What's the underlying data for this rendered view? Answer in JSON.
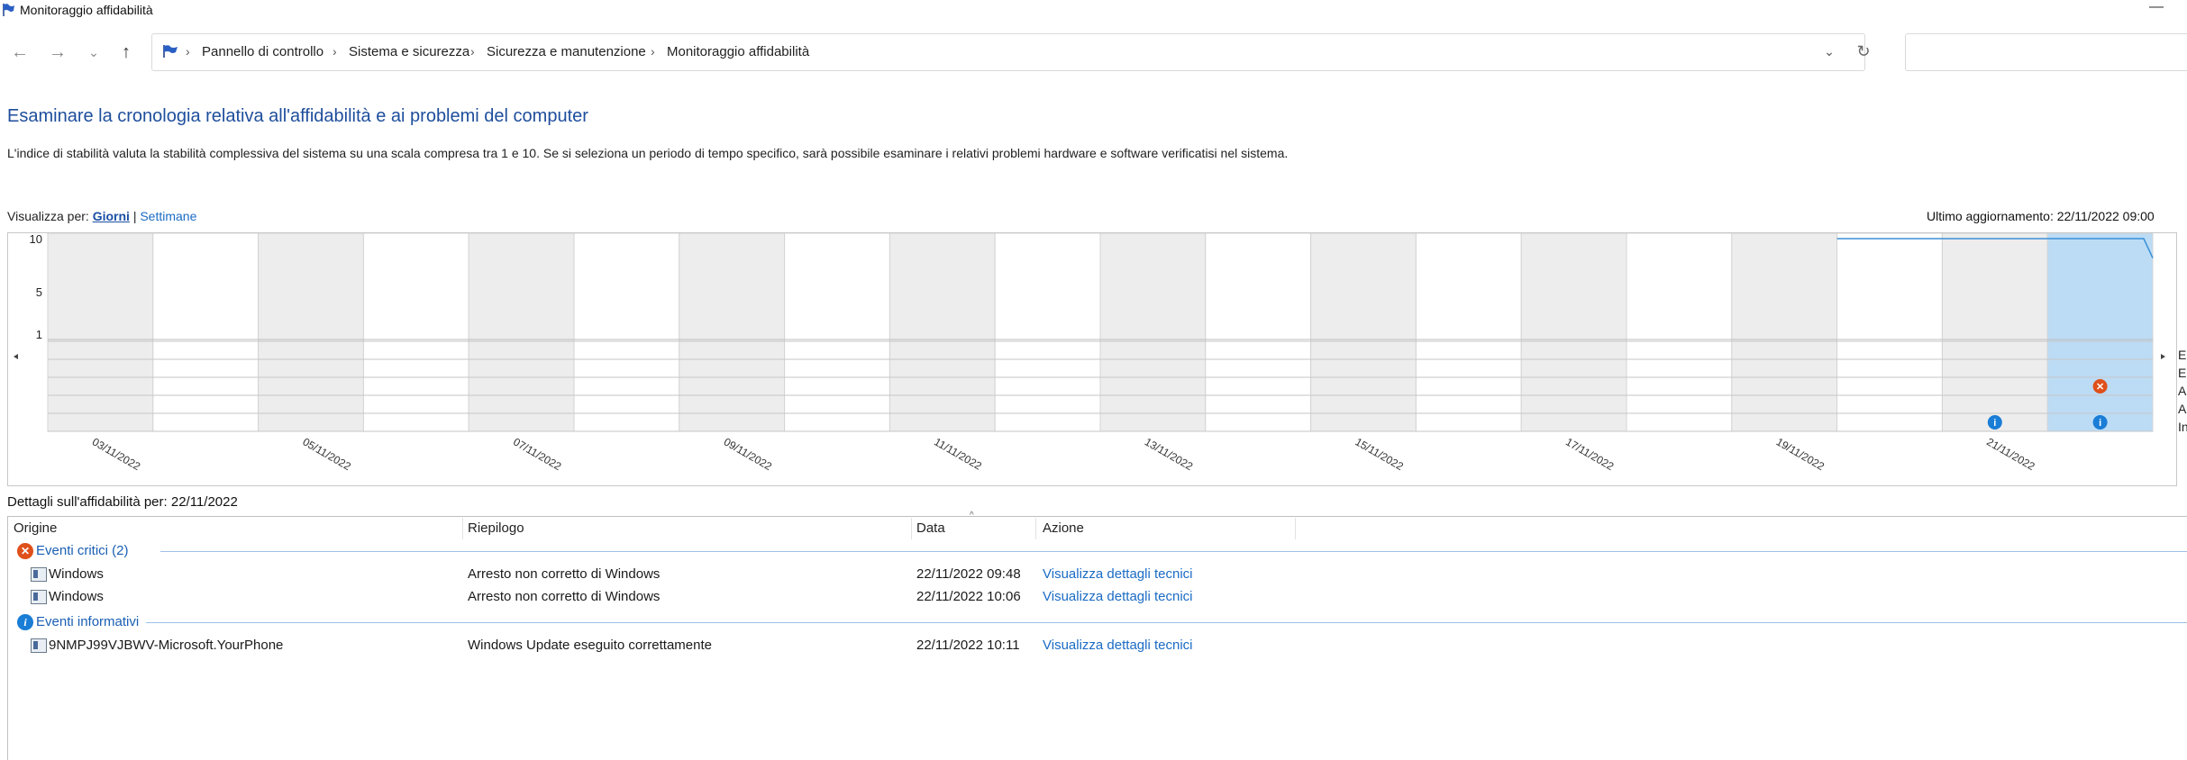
{
  "window": {
    "title": "Monitoraggio affidabilità"
  },
  "nav": {
    "back_icon": "arrow-left-icon",
    "forward_icon": "arrow-right-icon",
    "recent_icon": "chevron-down-icon",
    "up_icon": "arrow-up-icon"
  },
  "address": {
    "crumbs": [
      "Pannello di controllo",
      "Sistema e sicurezza",
      "Sicurezza e manutenzione",
      "Monitoraggio affidabilità"
    ]
  },
  "page": {
    "heading": "Esaminare la cronologia relativa all'affidabilità e ai problemi del computer",
    "description": "L'indice di stabilità valuta la stabilità complessiva del sistema su una scala compresa tra 1 e 10. Se si seleziona un periodo di tempo specifico, sarà possibile esaminare i relativi problemi hardware e software verificatisi nel sistema.",
    "view_by_label": "Visualizza per:",
    "view_days": "Giorni",
    "view_sep": "|",
    "view_weeks": "Settimane",
    "last_update": "Ultimo aggiornamento: 22/11/2022 09:00"
  },
  "chart_data": {
    "type": "line",
    "y_ticks": [
      "10",
      "5",
      "1"
    ],
    "ylim": [
      1,
      10
    ],
    "dates": [
      "03/11/2022",
      "05/11/2022",
      "07/11/2022",
      "09/11/2022",
      "11/11/2022",
      "13/11/2022",
      "15/11/2022",
      "17/11/2022",
      "19/11/2022",
      "21/11/2022"
    ],
    "stability_line": {
      "from_day": 20,
      "to_day": 22,
      "value": 10,
      "drop_end": 9.7
    },
    "selected_day": 22,
    "event_rows": 5,
    "critical_events": [
      {
        "day": 22,
        "row": 3
      }
    ],
    "info_events": [
      {
        "day": 21,
        "row": 5
      },
      {
        "day": 22,
        "row": 5
      }
    ],
    "legend_truncated": [
      "Er",
      "Er",
      "A",
      "A",
      "In"
    ],
    "colors": {
      "selected": "#bcdcf5",
      "line": "#3a8fd9",
      "critical": "#e0501a",
      "info": "#1a7dd6",
      "shade": "#ededed"
    }
  },
  "details": {
    "label": "Dettagli sull'affidabilità per: 22/11/2022",
    "columns": [
      "Origine",
      "Riepilogo",
      "Data",
      "Azione"
    ],
    "groups": [
      {
        "title": "Eventi critici (2)",
        "icon": "critical-x-icon",
        "rows": [
          {
            "source": "Windows",
            "summary": "Arresto non corretto di Windows",
            "date": "22/11/2022 09:48",
            "action": "Visualizza dettagli tecnici"
          },
          {
            "source": "Windows",
            "summary": "Arresto non corretto di Windows",
            "date": "22/11/2022 10:06",
            "action": "Visualizza dettagli tecnici"
          }
        ]
      },
      {
        "title": "Eventi informativi",
        "icon": "info-icon",
        "rows": [
          {
            "source": "9NMPJ99VJBWV-Microsoft.YourPhone",
            "summary": "Windows Update eseguito correttamente",
            "date": "22/11/2022 10:11",
            "action": "Visualizza dettagli tecnici"
          }
        ]
      }
    ]
  }
}
